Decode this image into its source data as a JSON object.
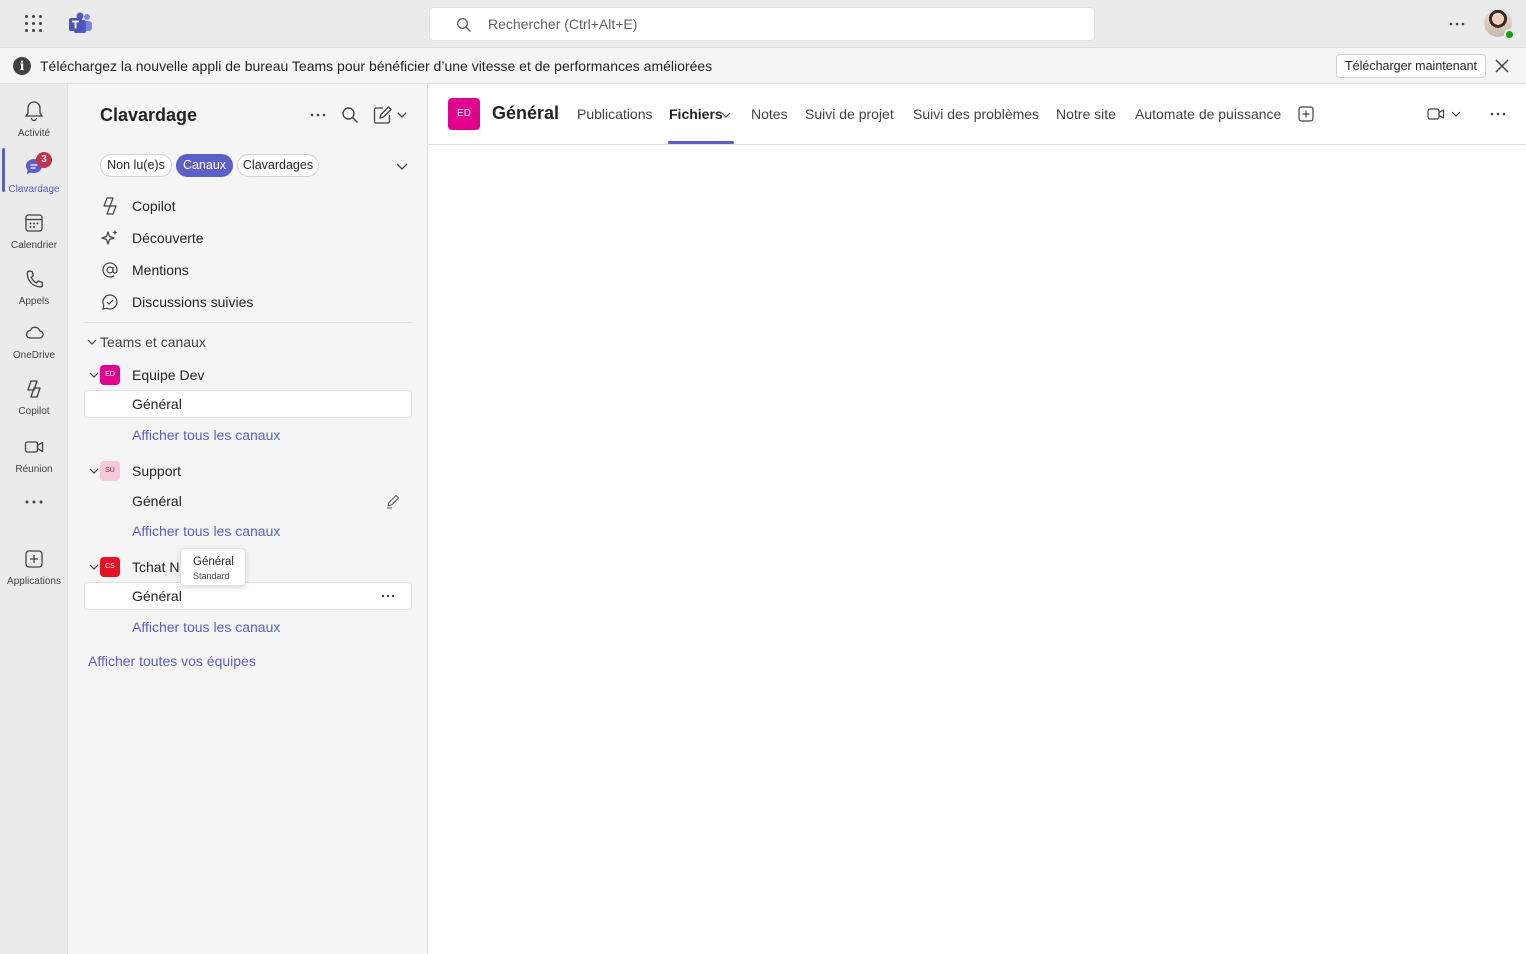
{
  "topbar": {
    "search_placeholder": "Rechercher (Ctrl+Alt+E)"
  },
  "banner": {
    "message": "Téléchargez la nouvelle appli de bureau Teams pour bénéficier d’une vitesse et de performances améliorées",
    "button_label": "Télécharger maintenant"
  },
  "rail": {
    "items": [
      {
        "label": "Activité",
        "icon": "bell-icon"
      },
      {
        "label": "Clavardage",
        "icon": "chat-icon",
        "badge": "3",
        "active": true
      },
      {
        "label": "Calendrier",
        "icon": "calendar-icon"
      },
      {
        "label": "Appels",
        "icon": "phone-icon"
      },
      {
        "label": "OneDrive",
        "icon": "cloud-icon"
      },
      {
        "label": "Copilot",
        "icon": "copilot-icon"
      },
      {
        "label": "Réunion",
        "icon": "video-icon"
      },
      {
        "label": "Applications",
        "icon": "add-apps-icon"
      }
    ]
  },
  "pane": {
    "title": "Clavardage",
    "filters": [
      "Non lu(e)s",
      "Canaux",
      "Clavardages"
    ],
    "active_filter": "Canaux",
    "nav": [
      {
        "label": "Copilot",
        "icon": "copilot-icon"
      },
      {
        "label": "Découverte",
        "icon": "sparkle-icon"
      },
      {
        "label": "Mentions",
        "icon": "at-icon"
      },
      {
        "label": "Discussions suivies",
        "icon": "followed-chat-icon"
      }
    ],
    "section_label": "Teams et canaux",
    "teams": [
      {
        "name": "Equipe Dev",
        "initials": "ED",
        "color": "#e3008c",
        "channel": "Général",
        "link": "Afficher tous les canaux"
      },
      {
        "name": "Support",
        "initials": "SU",
        "color": "#f7c9dc",
        "channel": "Général",
        "link": "Afficher tous les canaux"
      },
      {
        "name": "Tchat N",
        "initials": "CS",
        "color": "#e81123",
        "channel": "Général",
        "link": "Afficher tous les canaux"
      }
    ],
    "all_teams_link": "Afficher toutes vos équipes",
    "tooltip": {
      "title": "Général",
      "subtitle": "Standard"
    }
  },
  "main": {
    "channel_initials": "ED",
    "channel_title": "Général",
    "tabs": [
      "Publications",
      "Fichiers",
      "Notes",
      "Suivi de projet",
      "Suivi des problèmes",
      "Notre site",
      "Automate de puissance"
    ],
    "active_tab": "Fichiers"
  },
  "colors": {
    "accent": "#5b5fc7",
    "badge": "#c4314b",
    "presence": "#13a10e"
  }
}
